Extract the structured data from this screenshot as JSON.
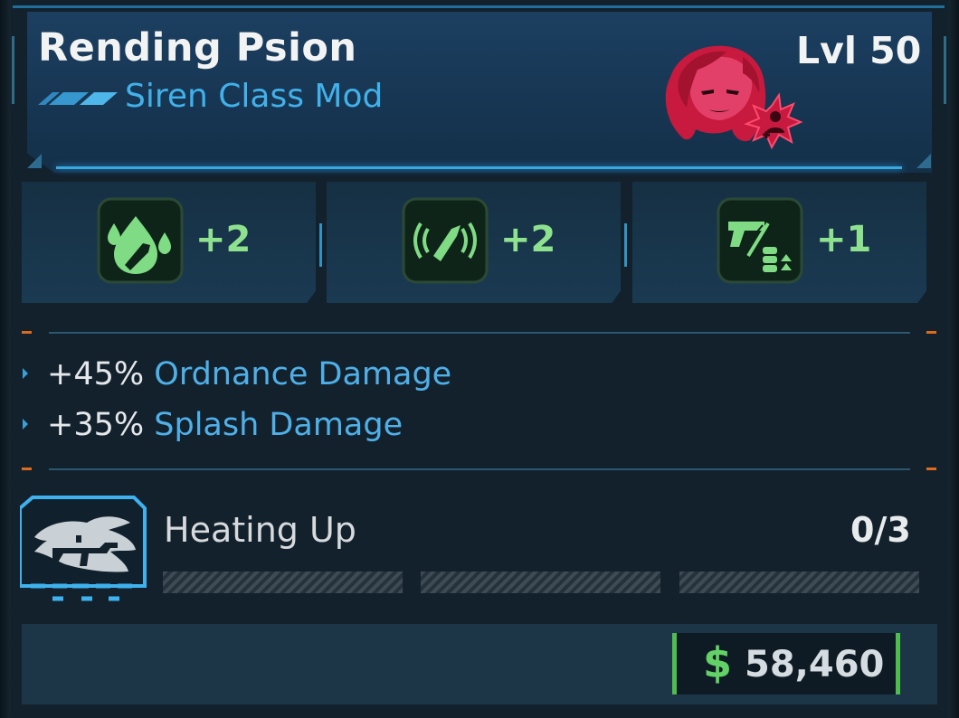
{
  "item": {
    "name": "Rending Psion",
    "type": "Siren Class Mod",
    "level": "Lvl 50"
  },
  "colors": {
    "accent_blue": "#41b1ea",
    "skill_green": "#8ee28f",
    "currency_green": "#4fbc4f",
    "portrait_red": "#e0284f",
    "orange_marker": "#dd6b1d"
  },
  "skills": [
    {
      "icon": "water-drop-bullet-icon",
      "value": "+2"
    },
    {
      "icon": "radiating-bullet-icon",
      "value": "+2"
    },
    {
      "icon": "pistol-ammo-upgrade-icon",
      "value": "+1"
    }
  ],
  "stats": [
    {
      "value": "+45%",
      "label": "Ordnance Damage"
    },
    {
      "value": "+35%",
      "label": "Splash Damage"
    }
  ],
  "perk": {
    "icon": "flaming-rifle-icon",
    "name": "Heating Up",
    "progress": "0/3",
    "filled_segments": 0,
    "total_segments": 3
  },
  "price": {
    "symbol": "$",
    "amount": "58,460"
  }
}
